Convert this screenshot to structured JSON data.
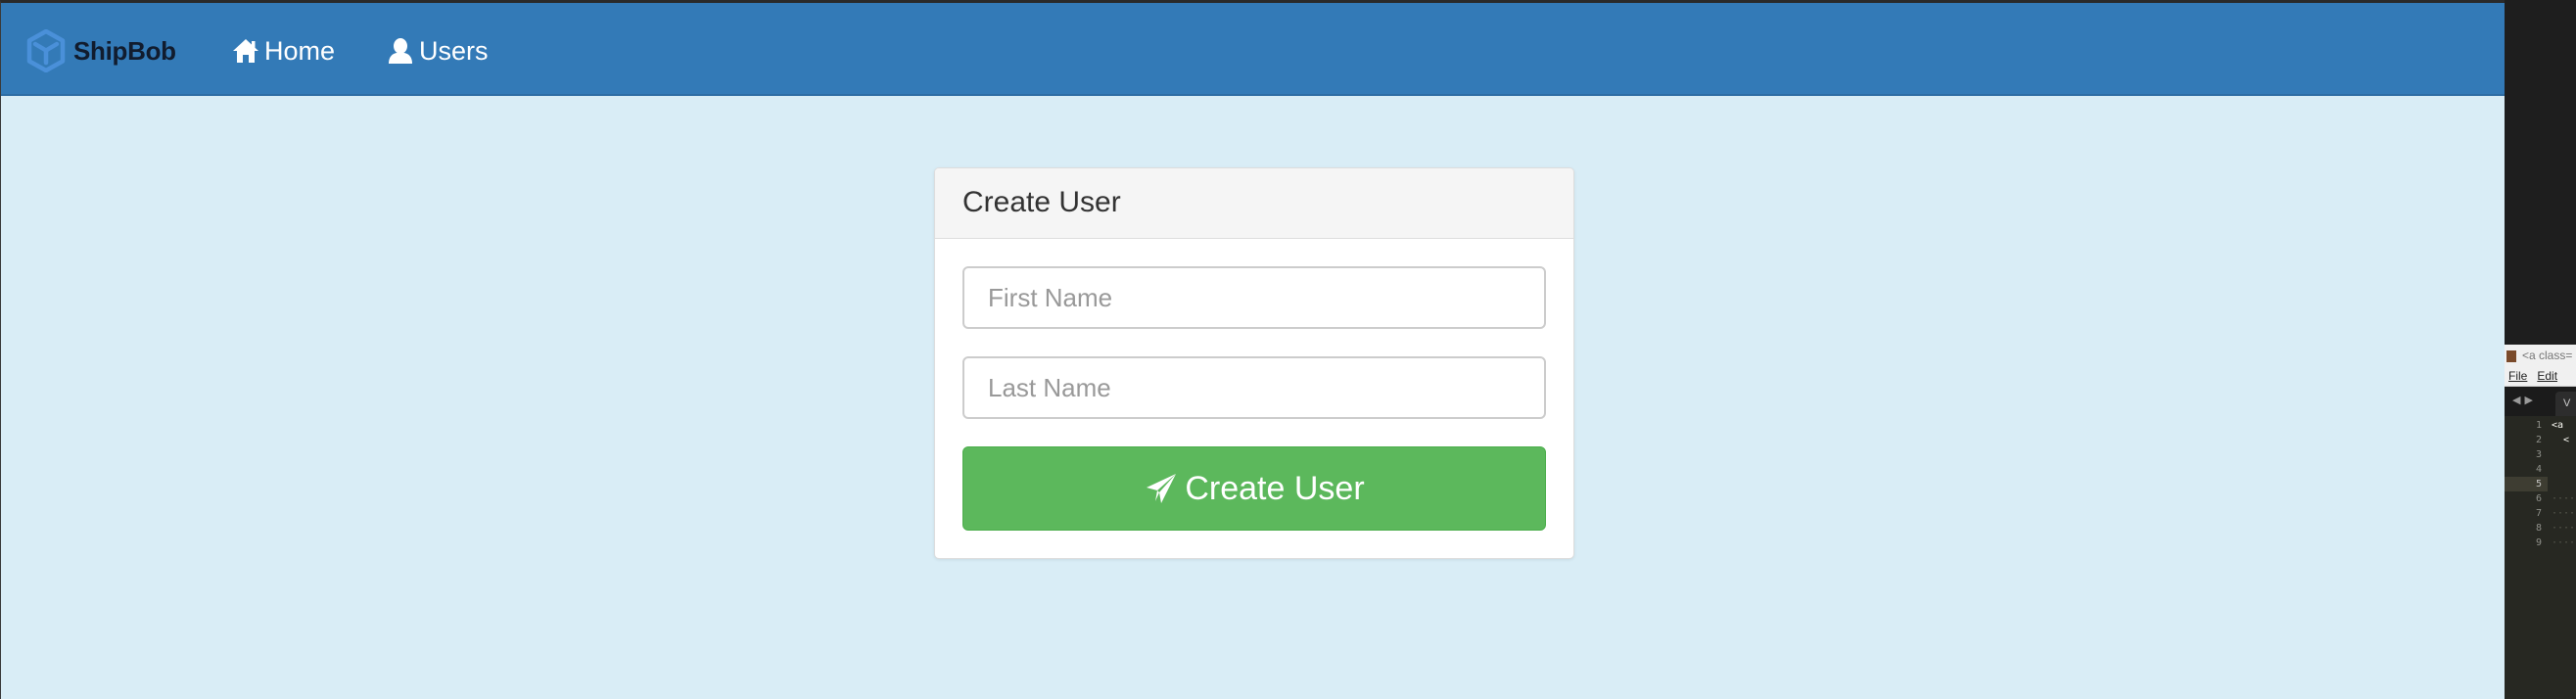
{
  "navbar": {
    "brand": "ShipBob",
    "links": [
      {
        "label": "Home",
        "icon": "home-icon"
      },
      {
        "label": "Users",
        "icon": "user-icon"
      }
    ]
  },
  "panel": {
    "title": "Create User",
    "fields": {
      "first_name_placeholder": "First Name",
      "first_name_value": "",
      "last_name_placeholder": "Last Name",
      "last_name_value": ""
    },
    "submit_label": "Create User",
    "submit_icon": "send-icon"
  },
  "editor": {
    "title": "<a class=",
    "menus": [
      "File",
      "Edit"
    ],
    "tab_label": "V",
    "line_numbers": [
      "1",
      "2",
      "3",
      "4",
      "5",
      "6",
      "7",
      "8",
      "9"
    ],
    "active_line": "5",
    "code_lines": [
      "<a",
      "  <",
      "",
      "",
      "",
      "····",
      "····",
      "····",
      "····"
    ]
  },
  "colors": {
    "navbar": "#337ab7",
    "page_background": "#d9edf6",
    "brand_text": "#111c2e",
    "brand_logo": "#4a90d9",
    "submit_button": "#5cb85c"
  }
}
